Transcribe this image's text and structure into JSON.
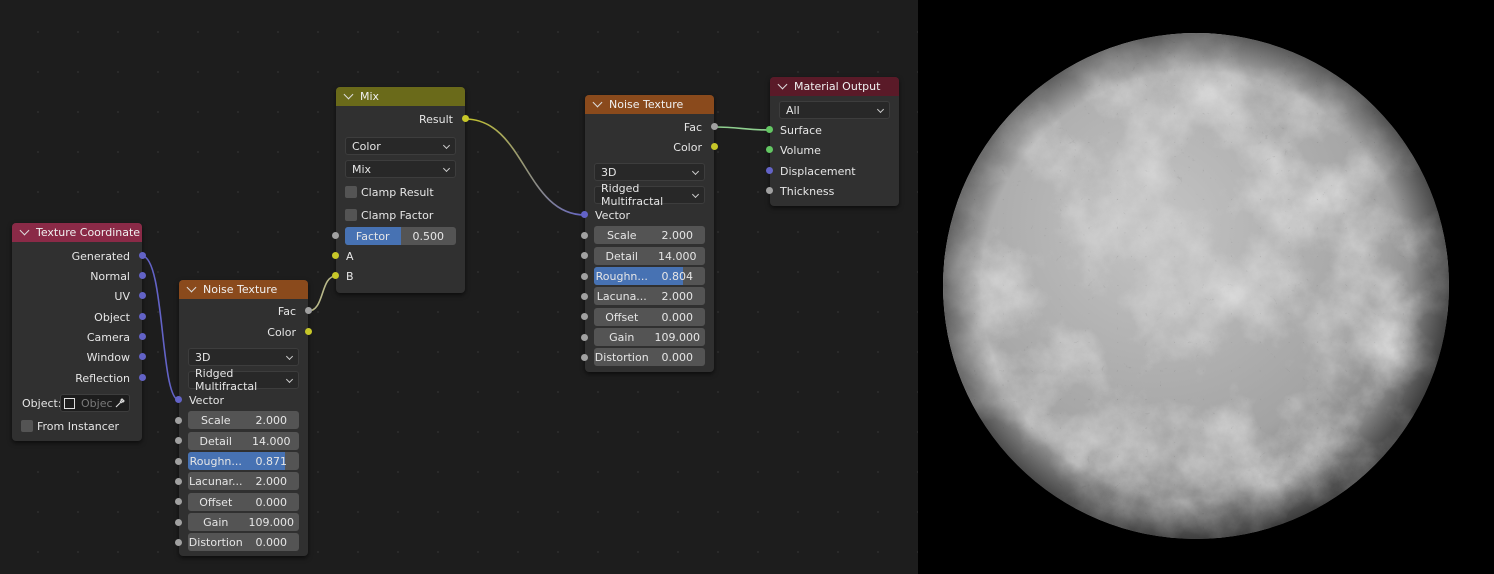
{
  "nodes": {
    "texture_coordinate": {
      "title": "Texture Coordinate",
      "header_color": "#8a2a47",
      "outputs": [
        "Generated",
        "Normal",
        "UV",
        "Object",
        "Camera",
        "Window",
        "Reflection"
      ],
      "object_label": "Object:",
      "object_placeholder": "Objec",
      "from_instancer": "From Instancer"
    },
    "mix": {
      "title": "Mix",
      "header_color": "#6a6a1a",
      "output": "Result",
      "data_type": "Color",
      "blend_mode": "Mix",
      "clamp_result": "Clamp Result",
      "clamp_factor": "Clamp Factor",
      "factor_label": "Factor",
      "factor_value": "0.500",
      "factor_fraction": 0.5,
      "input_a": "A",
      "input_b": "B"
    },
    "noise1": {
      "title": "Noise Texture",
      "header_color": "#8a4a1c",
      "out_fac": "Fac",
      "out_color": "Color",
      "dimensions": "3D",
      "type": "Ridged Multifractal",
      "vector": "Vector",
      "fields": [
        {
          "label": "Scale",
          "value": "2.000"
        },
        {
          "label": "Detail",
          "value": "14.000"
        },
        {
          "label": "Roughn...",
          "value": "0.871",
          "fraction": 0.871
        },
        {
          "label": "Lacunar...",
          "value": "2.000"
        },
        {
          "label": "Offset",
          "value": "0.000"
        },
        {
          "label": "Gain",
          "value": "109.000"
        },
        {
          "label": "Distortion",
          "value": "0.000"
        }
      ]
    },
    "noise2": {
      "title": "Noise Texture",
      "header_color": "#8a4a1c",
      "out_fac": "Fac",
      "out_color": "Color",
      "dimensions": "3D",
      "type": "Ridged Multifractal",
      "vector": "Vector",
      "fields": [
        {
          "label": "Scale",
          "value": "2.000"
        },
        {
          "label": "Detail",
          "value": "14.000"
        },
        {
          "label": "Roughn...",
          "value": "0.804",
          "fraction": 0.804
        },
        {
          "label": "Lacuna...",
          "value": "2.000"
        },
        {
          "label": "Offset",
          "value": "0.000"
        },
        {
          "label": "Gain",
          "value": "109.000"
        },
        {
          "label": "Distortion",
          "value": "0.000"
        }
      ]
    },
    "material_output": {
      "title": "Material Output",
      "header_color": "#5a1a28",
      "target": "All",
      "inputs": [
        "Surface",
        "Volume",
        "Displacement",
        "Thickness"
      ]
    }
  }
}
